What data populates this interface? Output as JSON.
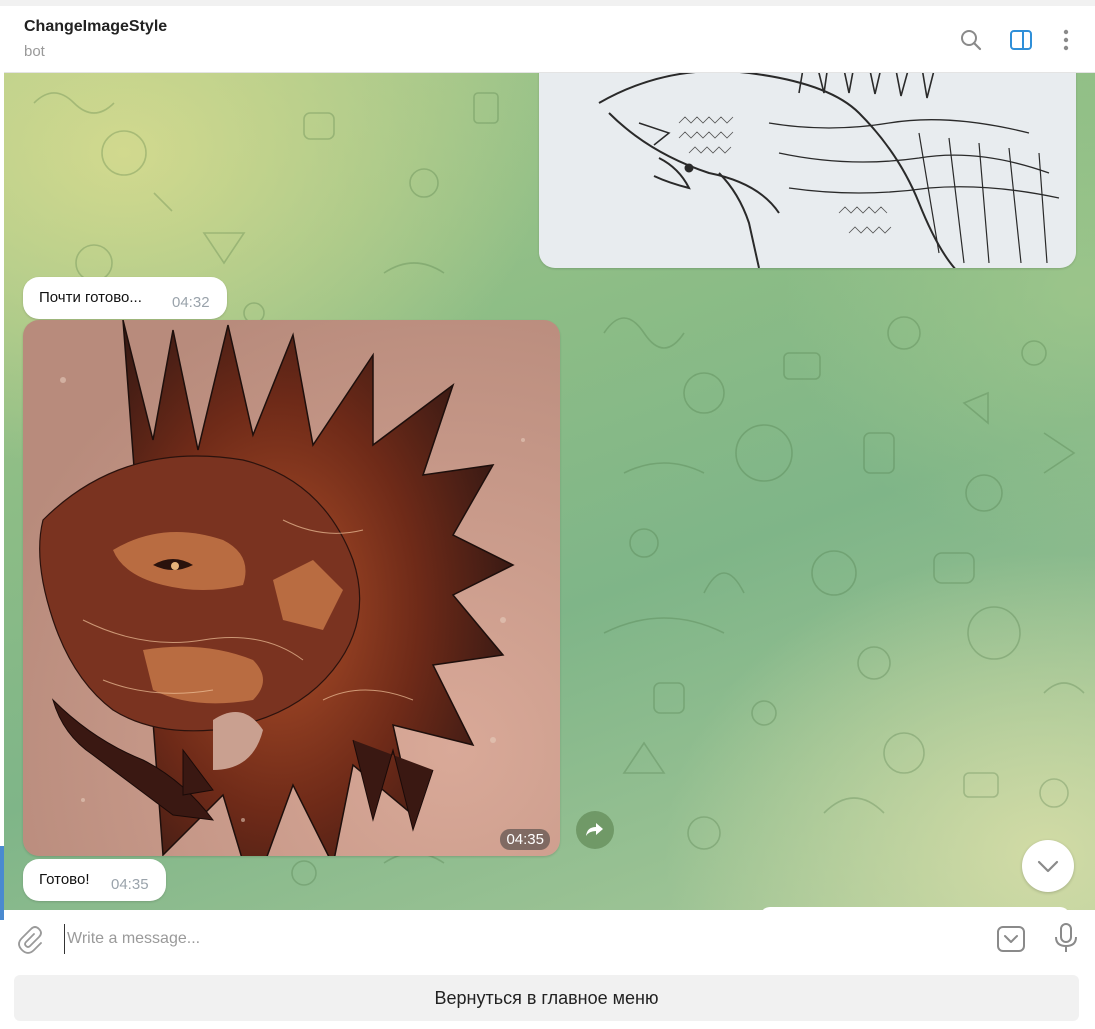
{
  "header": {
    "title": "ChangeImageStyle",
    "subtitle": "bot",
    "icons": [
      "search-icon",
      "sidebar-panel-icon",
      "more-vertical-icon"
    ],
    "accent_color": "#2f8fd8"
  },
  "messages": [
    {
      "type": "photo",
      "description_icon": "pencil-sketch-dragon-image"
    },
    {
      "type": "text",
      "text": "Почти готово...",
      "time": "04:32"
    },
    {
      "type": "photo",
      "description_icon": "stylized-dragon-image",
      "time": "04:35"
    },
    {
      "type": "text",
      "text": "Готово!",
      "time": "04:35"
    }
  ],
  "composer": {
    "placeholder": "Write a message...",
    "icons": [
      "paperclip-icon",
      "bot-keyboard-icon",
      "microphone-icon"
    ]
  },
  "reply_keyboard": {
    "button_label": "Вернуться в главное меню"
  },
  "colors": {
    "chat_background": "#8dbd86",
    "bubble_background": "#ffffff",
    "time_color": "#9aa3ab"
  }
}
